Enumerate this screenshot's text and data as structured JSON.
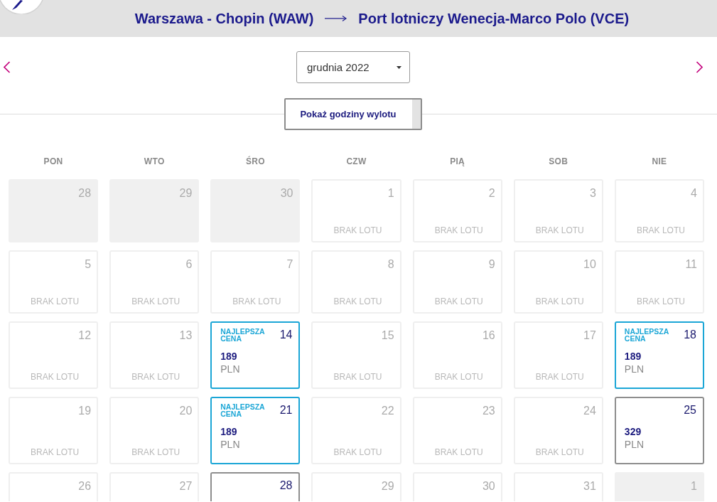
{
  "header": {
    "origin": "Warszawa - Chopin (WAW)",
    "destination": "Port lotniczy Wenecja-Marco Polo (VCE)"
  },
  "month_select": {
    "value": "grudnia 2022"
  },
  "show_times_button": {
    "label": "Pokaż godziny wylotu"
  },
  "weekdays": [
    "PON",
    "WTO",
    "ŚRO",
    "CZW",
    "PIĄ",
    "SOB",
    "NIE"
  ],
  "weeks": [
    {
      "days": [
        {
          "day": "28",
          "kind": "outside"
        },
        {
          "day": "29",
          "kind": "outside"
        },
        {
          "day": "30",
          "kind": "outside"
        },
        {
          "day": "1",
          "kind": "unavailable",
          "note": "BRAK LOTU"
        },
        {
          "day": "2",
          "kind": "unavailable",
          "note": "BRAK LOTU"
        },
        {
          "day": "3",
          "kind": "unavailable",
          "note": "BRAK LOTU"
        },
        {
          "day": "4",
          "kind": "unavailable",
          "note": "BRAK LOTU"
        }
      ]
    },
    {
      "days": [
        {
          "day": "5",
          "kind": "unavailable",
          "note": "BRAK LOTU"
        },
        {
          "day": "6",
          "kind": "unavailable",
          "note": "BRAK LOTU"
        },
        {
          "day": "7",
          "kind": "unavailable",
          "note": "BRAK LOTU"
        },
        {
          "day": "8",
          "kind": "unavailable",
          "note": "BRAK LOTU"
        },
        {
          "day": "9",
          "kind": "unavailable",
          "note": "BRAK LOTU"
        },
        {
          "day": "10",
          "kind": "unavailable",
          "note": "BRAK LOTU"
        },
        {
          "day": "11",
          "kind": "unavailable",
          "note": "BRAK LOTU"
        }
      ]
    },
    {
      "days": [
        {
          "day": "12",
          "kind": "unavailable",
          "note": "BRAK LOTU"
        },
        {
          "day": "13",
          "kind": "unavailable",
          "note": "BRAK LOTU"
        },
        {
          "day": "14",
          "kind": "fare",
          "best": true,
          "badge": "NAJLEPSZA CENA",
          "price": "189",
          "currency": "PLN"
        },
        {
          "day": "15",
          "kind": "unavailable",
          "note": "BRAK LOTU"
        },
        {
          "day": "16",
          "kind": "unavailable",
          "note": "BRAK LOTU"
        },
        {
          "day": "17",
          "kind": "unavailable",
          "note": "BRAK LOTU"
        },
        {
          "day": "18",
          "kind": "fare",
          "best": true,
          "badge": "NAJLEPSZA CENA",
          "price": "189",
          "currency": "PLN"
        }
      ]
    },
    {
      "days": [
        {
          "day": "19",
          "kind": "unavailable",
          "note": "BRAK LOTU"
        },
        {
          "day": "20",
          "kind": "unavailable",
          "note": "BRAK LOTU"
        },
        {
          "day": "21",
          "kind": "fare",
          "best": true,
          "badge": "NAJLEPSZA CENA",
          "price": "189",
          "currency": "PLN"
        },
        {
          "day": "22",
          "kind": "unavailable",
          "note": "BRAK LOTU"
        },
        {
          "day": "23",
          "kind": "unavailable",
          "note": "BRAK LOTU"
        },
        {
          "day": "24",
          "kind": "unavailable",
          "note": "BRAK LOTU"
        },
        {
          "day": "25",
          "kind": "fare",
          "best": false,
          "price": "329",
          "currency": "PLN"
        }
      ]
    },
    {
      "days": [
        {
          "day": "26",
          "kind": "unavailable"
        },
        {
          "day": "27",
          "kind": "unavailable"
        },
        {
          "day": "28",
          "kind": "fare",
          "best": false
        },
        {
          "day": "29",
          "kind": "unavailable"
        },
        {
          "day": "30",
          "kind": "unavailable"
        },
        {
          "day": "31",
          "kind": "unavailable"
        },
        {
          "day": "1",
          "kind": "outside"
        }
      ]
    }
  ]
}
